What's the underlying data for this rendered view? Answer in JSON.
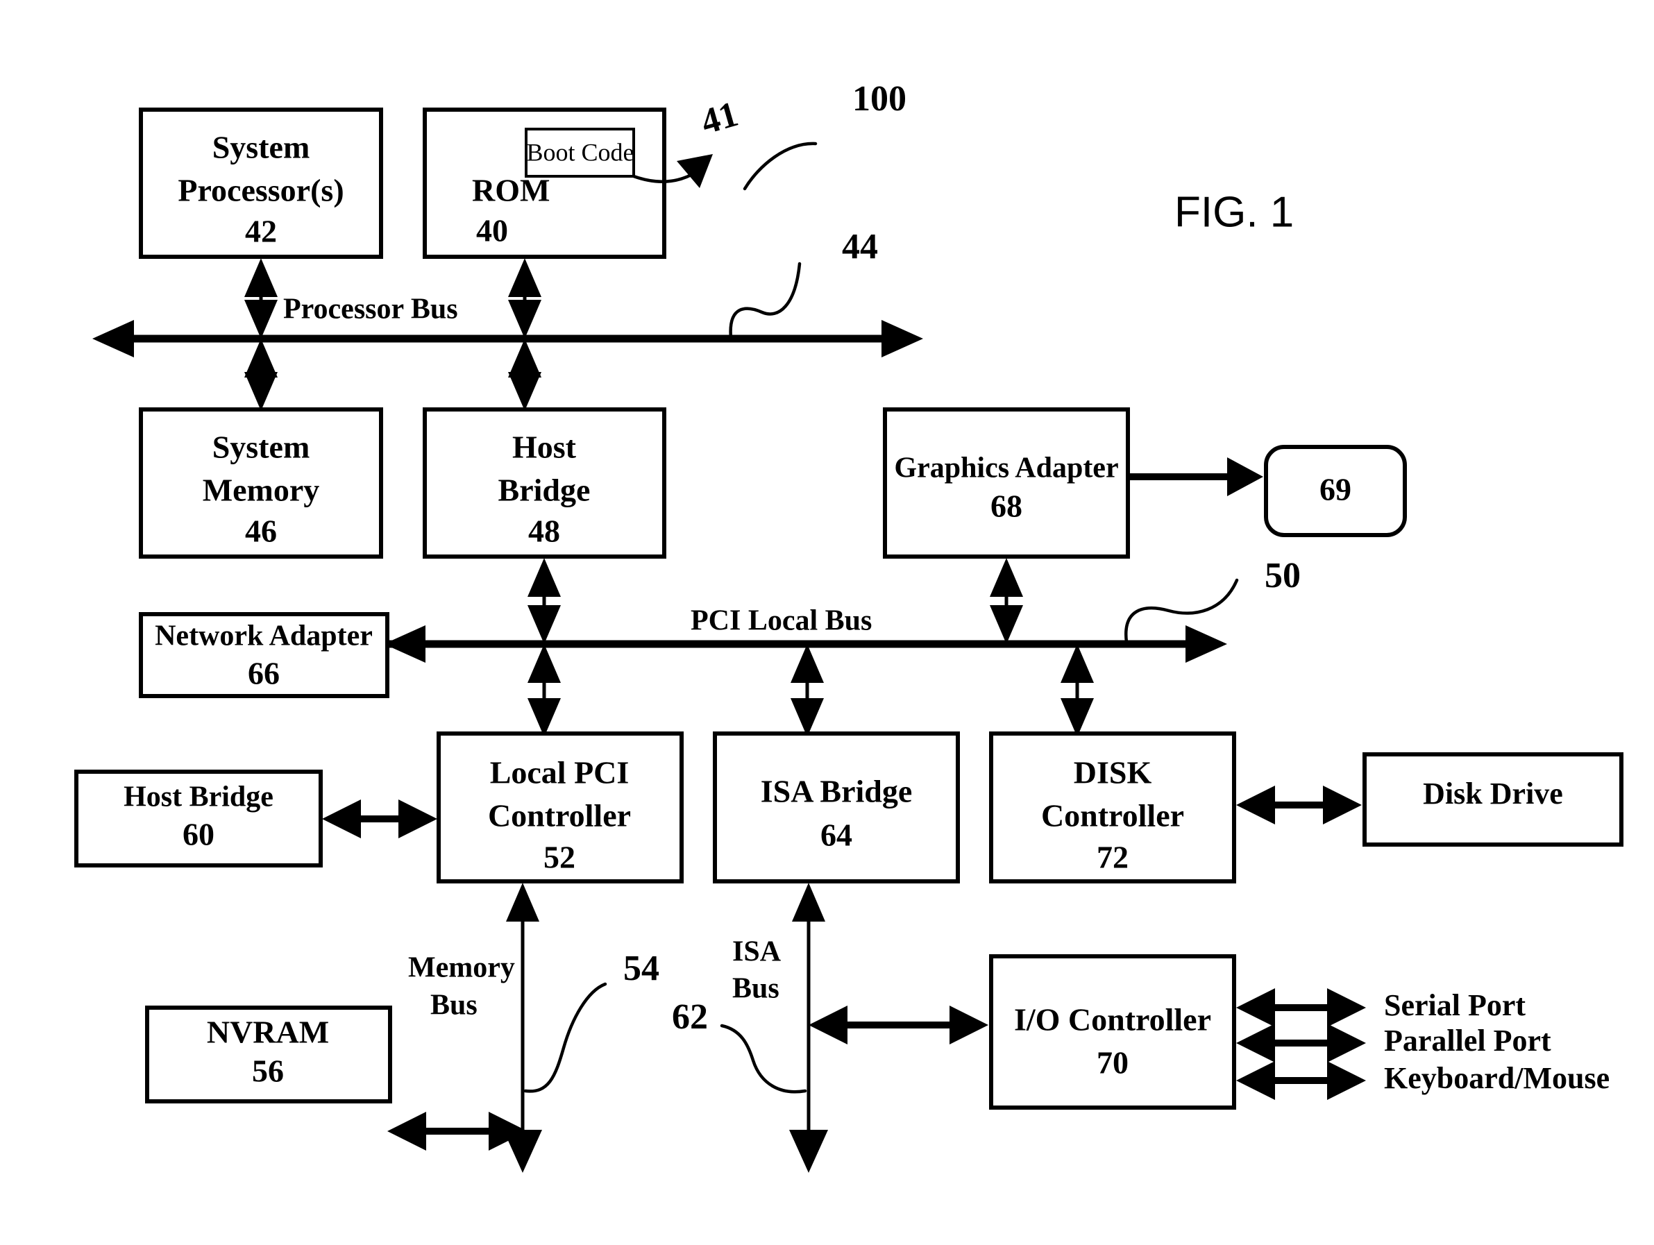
{
  "figure": {
    "caption": "FIG. 1",
    "system_callout": "100"
  },
  "boxes": {
    "system_processor": {
      "line1": "System",
      "line2": "Processor(s)",
      "ref": "42"
    },
    "rom": {
      "label": "ROM",
      "ref": "40",
      "inner": {
        "label": "Boot Code",
        "ref": "41"
      }
    },
    "system_memory": {
      "line1": "System",
      "line2": "Memory",
      "ref": "46"
    },
    "host_bridge_48": {
      "line1": "Host",
      "line2": "Bridge",
      "ref": "48"
    },
    "graphics_adapter": {
      "label": "Graphics Adapter",
      "ref": "68"
    },
    "display": {
      "ref": "69"
    },
    "network_adapter": {
      "label": "Network Adapter",
      "ref": "66"
    },
    "host_bridge_60": {
      "label": "Host Bridge",
      "ref": "60"
    },
    "local_pci_controller": {
      "line1": "Local PCI",
      "line2": "Controller",
      "ref": "52"
    },
    "isa_bridge": {
      "label": "ISA Bridge",
      "ref": "64"
    },
    "disk_controller": {
      "line1": "DISK",
      "line2": "Controller",
      "ref": "72"
    },
    "disk_drive": {
      "label": "Disk Drive"
    },
    "nvram": {
      "label": "NVRAM",
      "ref": "56"
    },
    "io_controller": {
      "label": "I/O Controller",
      "ref": "70"
    }
  },
  "buses": {
    "processor_bus": {
      "label": "Processor Bus",
      "ref": "44"
    },
    "pci_local_bus": {
      "label": "PCI Local Bus",
      "ref": "50"
    },
    "memory_bus": {
      "line1": "Memory",
      "line2": "Bus",
      "ref": "54"
    },
    "isa_bus": {
      "line1": "ISA",
      "line2": "Bus",
      "ref": "62"
    }
  },
  "ports": [
    {
      "label": "Serial Port"
    },
    {
      "label": "Parallel Port"
    },
    {
      "label": "Keyboard/Mouse"
    }
  ],
  "colors": {
    "ink": "#000000",
    "paper": "#ffffff"
  }
}
